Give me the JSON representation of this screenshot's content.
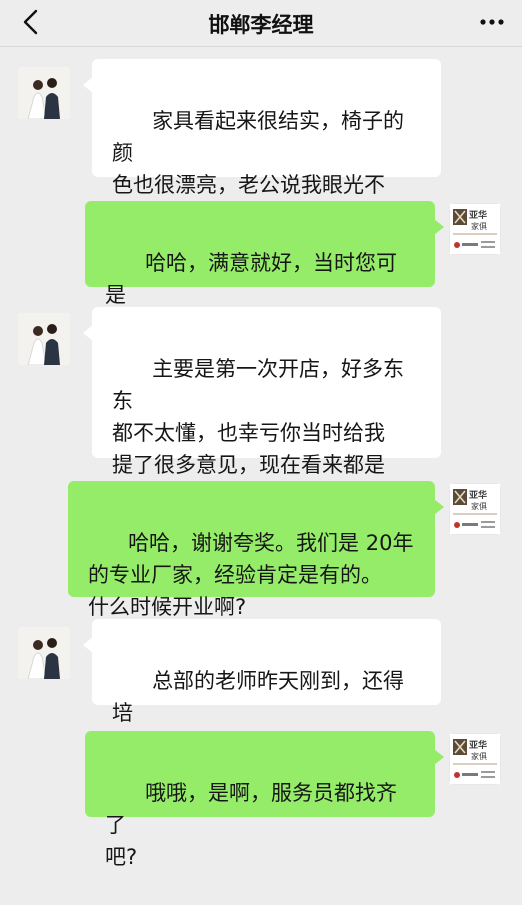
{
  "header": {
    "title": "邯郸李经理",
    "back_icon": "chevron-left-icon",
    "more_icon": "ellipsis-icon"
  },
  "messages": [
    {
      "side": "left",
      "text": "家具看起来很结实，椅子的颜\n色也很漂亮，老公说我眼光不\n错呢",
      "emoji": "tongue-wink-emoji"
    },
    {
      "side": "right",
      "text": "哈哈，满意就好，当时您可是\n纠结了好长时间呢",
      "emoji": "grin-emoji"
    },
    {
      "side": "left",
      "text": "主要是第一次开店，好多东东\n都不太懂，也幸亏你当时给我\n提了很多意见，现在看来都是\n对的"
    },
    {
      "side": "right",
      "text": "哈哈，谢谢夸奖。我们是 20年\n的专业厂家，经验肯定是有的。\n什么时候开业啊?"
    },
    {
      "side": "left",
      "text": "总部的老师昨天刚到，还得培\n训几天"
    },
    {
      "side": "right",
      "text": "哦哦，是啊，服务员都找齐了\n吧?"
    }
  ],
  "brand": {
    "logo_text_top": "亚华",
    "logo_text_bottom": "家俱"
  },
  "colors": {
    "background": "#ededed",
    "bubble_self": "#95ec69",
    "bubble_other": "#ffffff"
  }
}
